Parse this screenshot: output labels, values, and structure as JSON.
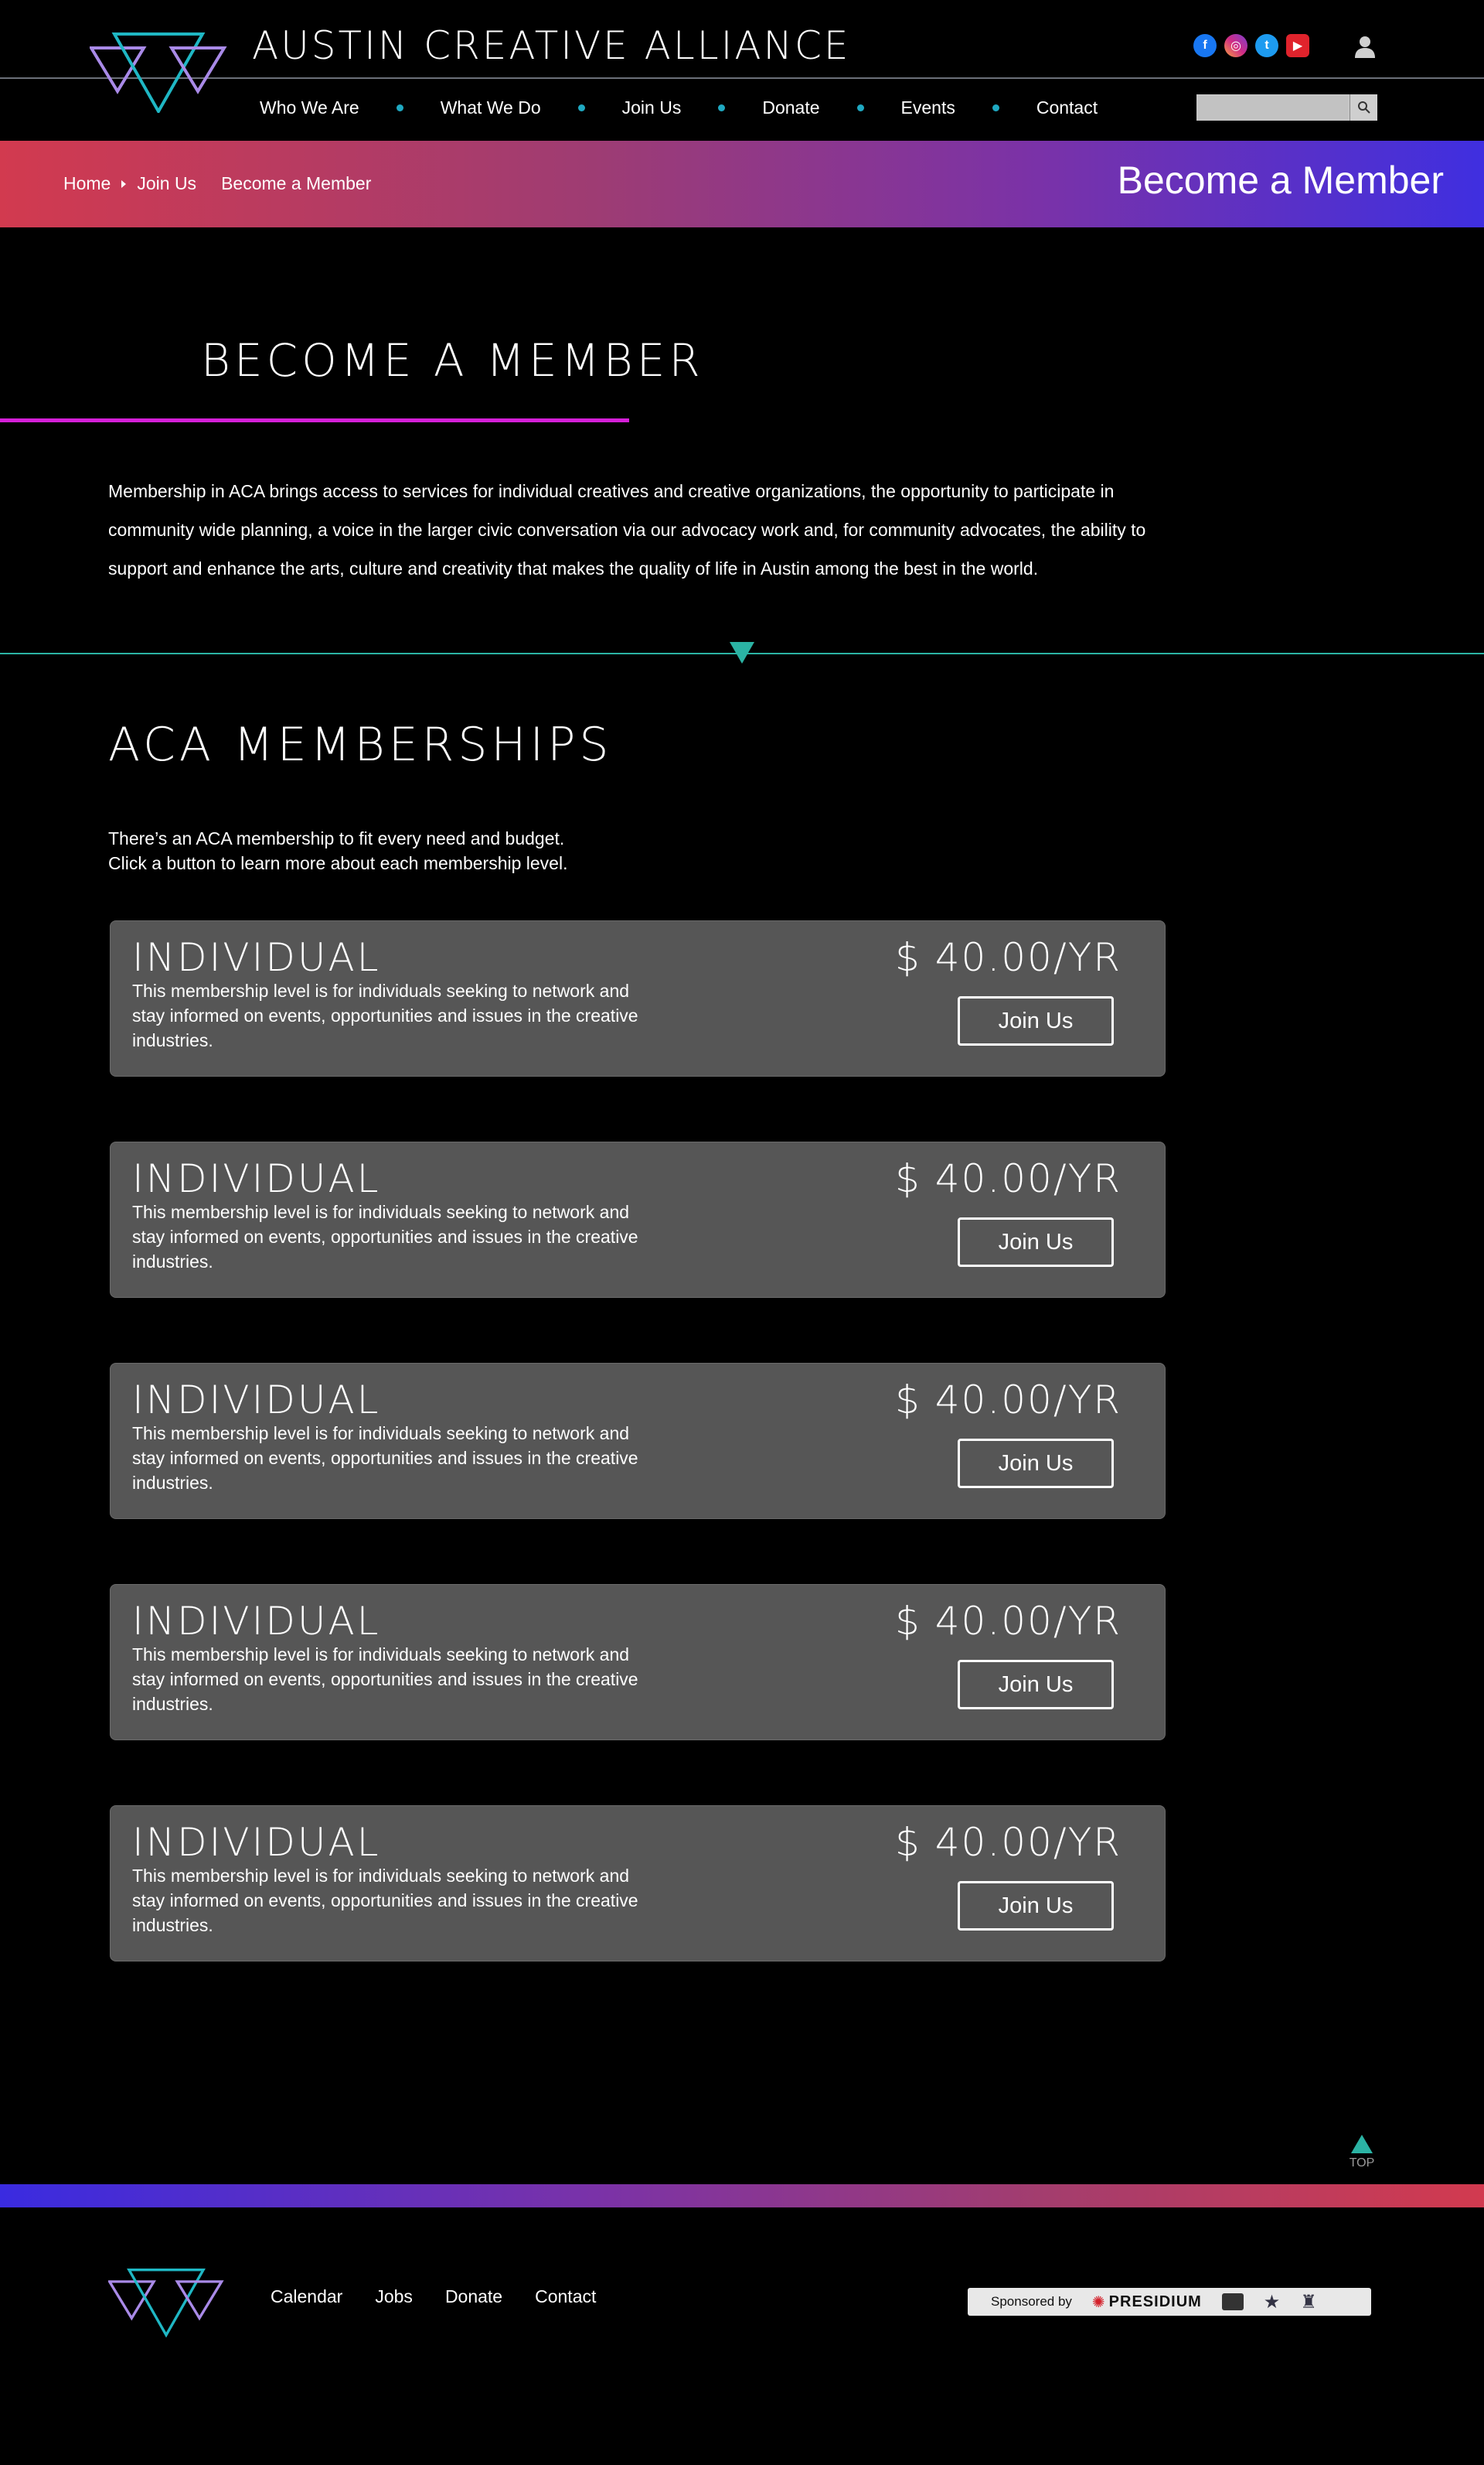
{
  "header": {
    "site_title": "AUSTIN CREATIVE ALLIANCE",
    "nav": [
      "Who We Are",
      "What We Do",
      "Join Us",
      "Donate",
      "Events",
      "Contact"
    ],
    "social_icons": [
      "facebook-icon",
      "instagram-icon",
      "twitter-icon",
      "youtube-icon"
    ],
    "search": {
      "placeholder": "",
      "value": ""
    }
  },
  "banner": {
    "breadcrumb": [
      "Home",
      "Join Us",
      "Become a Member"
    ],
    "title": "Become a Member"
  },
  "main": {
    "heading": "BECOME A MEMBER",
    "intro": "Membership in ACA brings access to services for individual creatives and creative organizations, the opportunity to participate in community wide planning, a voice in the larger civic conversation via our advocacy work and, for community advocates, the ability to support and enhance the arts, culture and creativity that makes the quality of life in Austin among the best in the world.",
    "section_title": "ACA MEMBERSHIPS",
    "section_sub_1": "There’s an ACA membership to fit every need and budget.",
    "section_sub_2": "Click a button to learn more about each membership level.",
    "memberships": [
      {
        "level": "INDIVIDUAL",
        "price": "$ 40.00/YR",
        "description": "This membership level is for individuals seeking to network and stay informed on events, opportunities and issues in the creative industries.",
        "button": "Join Us"
      },
      {
        "level": "INDIVIDUAL",
        "price": "$ 40.00/YR",
        "description": "This membership level is for individuals seeking to network and stay informed on events, opportunities and issues in the creative industries.",
        "button": "Join Us"
      },
      {
        "level": "INDIVIDUAL",
        "price": "$ 40.00/YR",
        "description": "This membership level is for individuals seeking to network and stay informed on events, opportunities and issues in the creative industries.",
        "button": "Join Us"
      },
      {
        "level": "INDIVIDUAL",
        "price": "$ 40.00/YR",
        "description": "This membership level is for individuals seeking to network and stay informed on events, opportunities and issues in the creative industries.",
        "button": "Join Us"
      },
      {
        "level": "INDIVIDUAL",
        "price": "$ 40.00/YR",
        "description": "This membership level is for individuals seeking to network and stay informed on events, opportunities and issues in the creative industries.",
        "button": "Join Us"
      }
    ],
    "top_label": "TOP"
  },
  "footer": {
    "nav": [
      "Calendar",
      "Jobs",
      "Donate",
      "Contact"
    ],
    "sponsored_by": "Sponsored by",
    "sponsor_name": "PRESIDIUM"
  },
  "colors": {
    "accent_teal": "#2bb3a4",
    "accent_magenta": "#d51fd8",
    "card_bg": "#565656",
    "banner_start": "#d23a4f",
    "banner_end": "#3f2fe0"
  }
}
